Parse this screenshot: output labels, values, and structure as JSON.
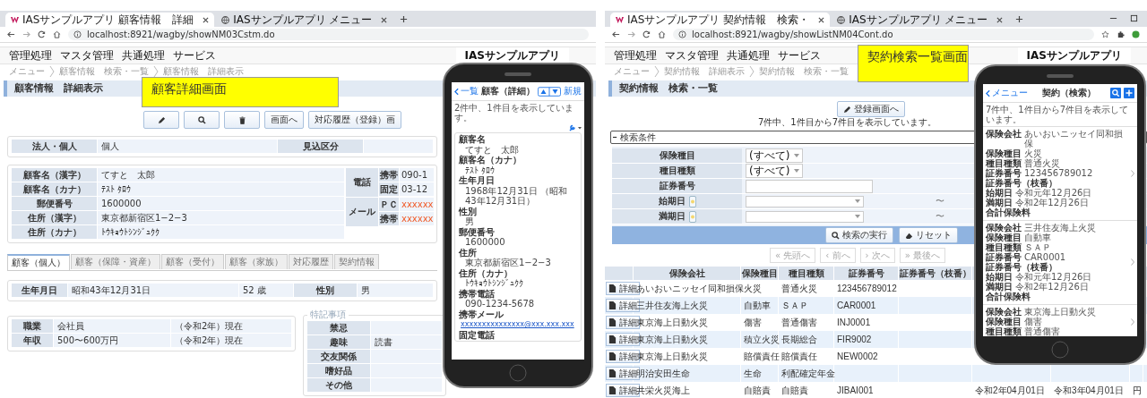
{
  "windows": [
    {
      "kind": "customer_detail",
      "browser_tabs": [
        {
          "title": "IASサンプルアプリ 顧客情報　詳細",
          "selected": true
        },
        {
          "title": "IASサンプルアプリ メニュー",
          "selected": false
        }
      ],
      "address": "localhost:8921/wagby/showNM03Cstm.do",
      "menu": [
        "管理処理",
        "マスタ管理",
        "共通処理",
        "サービス"
      ],
      "app_title": "IASサンプルアプリ",
      "breadcrumb": [
        "メニュー",
        "顧客情報　検索・一覧",
        "顧客情報　詳細表示"
      ],
      "page_title": "顧客情報　詳細表示",
      "callout": "顧客詳細画面",
      "actions": [
        {
          "kind": "edit"
        },
        {
          "kind": "search"
        },
        {
          "kind": "delete"
        },
        {
          "kind": "text",
          "label": "画面へ"
        },
        {
          "kind": "text",
          "label": "対応履歴（登録）画"
        }
      ],
      "summary": [
        {
          "label": "法人・個人",
          "value": "個人"
        },
        {
          "label": "見込区分"
        }
      ],
      "customer": [
        {
          "label": "顧客名（漢字）",
          "value": "てすと　太郎"
        },
        {
          "label": "顧客名（カナ）",
          "value": "ﾃｽﾄ ﾀﾛｳ"
        },
        {
          "label": "郵便番号",
          "value": "1600000"
        },
        {
          "label": "住所（漢字）",
          "value": "東京都新宿区1−2−3"
        },
        {
          "label": "住所（カナ）",
          "value": "ﾄｳｷｮｳﾄｼﾝｼﾞｭｸｸ"
        }
      ],
      "contacts": [
        {
          "label": "電話",
          "items": [
            {
              "label": "携帯",
              "value": "090-1",
              "kind": "text"
            },
            {
              "label": "固定",
              "value": "03-12",
              "kind": "text"
            }
          ]
        },
        {
          "label": "メール",
          "items": [
            {
              "label": "ＰＣ",
              "value": "xxxxxx",
              "kind": "mail"
            },
            {
              "label": "携帯",
              "value": "xxxxxx",
              "kind": "mail"
            }
          ]
        }
      ],
      "detail_tabs": [
        {
          "label": "顧客（個人）",
          "selected": true
        },
        {
          "label": "顧客（保障・資産）",
          "selected": false
        },
        {
          "label": "顧客（受付）",
          "selected": false
        },
        {
          "label": "顧客（家族）",
          "selected": false
        },
        {
          "label": "対応履歴",
          "selected": false
        },
        {
          "label": "契約情報",
          "selected": false
        }
      ],
      "birth": {
        "label": "生年月日",
        "value": "昭和43年12月31日",
        "age": "52 歳",
        "gender_label": "性別",
        "gender": "男"
      },
      "job": [
        {
          "label": "職業",
          "value": "会社員",
          "note": "（令和2年）現在"
        },
        {
          "label": "年収",
          "value": "500〜600万円",
          "note": "（令和2年）現在"
        }
      ],
      "notes": {
        "legend": "特記事項",
        "rows": [
          {
            "label": "禁忌"
          },
          {
            "label": "趣味",
            "value": "読書"
          },
          {
            "label": "交友関係"
          },
          {
            "label": "嗜好品"
          },
          {
            "label": "その他"
          }
        ]
      },
      "phone": {
        "back": "一覧",
        "title": "顧客（詳細）",
        "action": "新規",
        "count": "2件中、1件目を表示しています。",
        "fields": [
          {
            "label": "顧客名",
            "value": "てすと　太郎",
            "kind": "text"
          },
          {
            "label": "顧客名（カナ）",
            "value": "ﾃｽﾄ ﾀﾛｳ",
            "kind": "text"
          },
          {
            "label": "生年月日",
            "value": "1968年12月31日 （昭和43年12月31日）",
            "kind": "text"
          },
          {
            "label": "性別",
            "value": "男",
            "kind": "text"
          },
          {
            "label": "郵便番号",
            "value": "1600000",
            "kind": "text"
          },
          {
            "label": "住所",
            "value": "東京都新宿区1−2−3",
            "kind": "text"
          },
          {
            "label": "住所（カナ）",
            "value": "ﾄｳｷｮｳﾄｼﾝｼﾞｭｸｸ",
            "kind": "text"
          },
          {
            "label": "携帯電話",
            "value": "090-1234-5678",
            "kind": "text"
          },
          {
            "label": "携帯メール",
            "value": "xxxxxxxxxxxxxxx@xxx.xxx.xxx",
            "kind": "link"
          },
          {
            "label": "固定電話"
          }
        ]
      }
    },
    {
      "kind": "contract_search",
      "browser_tabs": [
        {
          "title": "IASサンプルアプリ 契約情報　検索・",
          "selected": true
        },
        {
          "title": "IASサンプルアプリ メニュー",
          "selected": false
        }
      ],
      "address": "localhost:8921/wagby/showListNM04Cont.do",
      "menu": [
        "管理処理",
        "マスタ管理",
        "共通処理",
        "サービス"
      ],
      "app_title": "IASサンプルアプリ",
      "breadcrumb": [
        "メニュー",
        "契約情報　詳細表示",
        "契約情報　検索・一覧"
      ],
      "page_title": "契約情報　検索・一覧",
      "callout": "契約検索一覧画面",
      "register_button": "登録画面へ",
      "count": "7件中、1件目から7件目を表示しています。",
      "search_title": "検索条件",
      "filters": [
        {
          "label": "保険種目",
          "kind": "select",
          "value": "(すべて)"
        },
        {
          "label": "種目種類",
          "kind": "select",
          "value": "(すべて)"
        },
        {
          "label": "証券番号",
          "kind": "text"
        },
        {
          "label": "始期日",
          "kind": "date_range",
          "separator": "〜"
        },
        {
          "label": "満期日",
          "kind": "date_range",
          "separator": "〜"
        }
      ],
      "search_buttons": [
        {
          "label": "検索の実行",
          "kind": "search"
        },
        {
          "label": "リセット",
          "kind": "reset"
        }
      ],
      "pager": [
        {
          "label": "« 先頭へ",
          "disabled": true
        },
        {
          "label": "‹ 前へ",
          "disabled": true
        },
        {
          "label": "› 次へ",
          "disabled": true
        },
        {
          "label": "» 最後へ",
          "disabled": true
        }
      ],
      "table": {
        "columns": [
          "保険会社",
          "保険種目",
          "種目種類",
          "証券番号",
          "証券番号（枝番）"
        ],
        "rows": [
          {
            "button": "詳細",
            "company": "あいおいニッセイ同和損保",
            "type": "火災",
            "subtype": "普通火災",
            "number": "123456789012"
          },
          {
            "button": "詳細",
            "company": "三井住友海上火災",
            "type": "自動車",
            "subtype": "ＳＡＰ",
            "number": "CAR0001"
          },
          {
            "button": "詳細",
            "company": "東京海上日動火災",
            "type": "傷害",
            "subtype": "普通傷害",
            "number": "INJ0001"
          },
          {
            "button": "詳細",
            "company": "東京海上日動火災",
            "type": "積立火災",
            "subtype": "長期総合",
            "number": "FIR9002"
          },
          {
            "button": "詳細",
            "company": "東京海上日動火災",
            "type": "賠償責任",
            "subtype": "賠償責任",
            "number": "NEW0002"
          },
          {
            "button": "詳細",
            "company": "明治安田生命",
            "type": "生命",
            "subtype": "利配確定年金"
          },
          {
            "button": "詳細",
            "company": "共栄火災海上",
            "type": "自賠責",
            "subtype": "自賠責",
            "number": "JIBAI001",
            "start": "令和2年04月01日",
            "end": "令和3年04月01日",
            "premium": "円"
          }
        ]
      },
      "phone": {
        "back": "メニュー",
        "title": "契約（検索）",
        "count": "7件中、1件目から7件目を表示しています。",
        "cards": [
          {
            "fields": [
              {
                "label": "保険会社",
                "value": "あいおいニッセイ同和損保"
              },
              {
                "label": "保険種目",
                "value": "火災"
              },
              {
                "label": "種目種類",
                "value": "普通火災"
              },
              {
                "label": "証券番号",
                "value": "123456789012"
              },
              {
                "label": "証券番号（枝番）"
              },
              {
                "label": "始期日",
                "value": "令和元年12月26日"
              },
              {
                "label": "満期日",
                "value": "令和2年12月26日"
              },
              {
                "label": "合計保険料"
              }
            ]
          },
          {
            "fields": [
              {
                "label": "保険会社",
                "value": "三井住友海上火災"
              },
              {
                "label": "保険種目",
                "value": "自動車"
              },
              {
                "label": "種目種類",
                "value": "ＳＡＰ"
              },
              {
                "label": "証券番号",
                "value": "CAR0001"
              },
              {
                "label": "証券番号（枝番）"
              },
              {
                "label": "始期日",
                "value": "令和元年12月26日"
              },
              {
                "label": "満期日",
                "value": "令和2年12月26日"
              },
              {
                "label": "合計保険料"
              }
            ]
          },
          {
            "fields": [
              {
                "label": "保険会社",
                "value": "東京海上日動火災"
              },
              {
                "label": "保険種目",
                "value": "傷害"
              },
              {
                "label": "種目種類",
                "value": "普通傷害"
              }
            ]
          }
        ]
      }
    }
  ]
}
